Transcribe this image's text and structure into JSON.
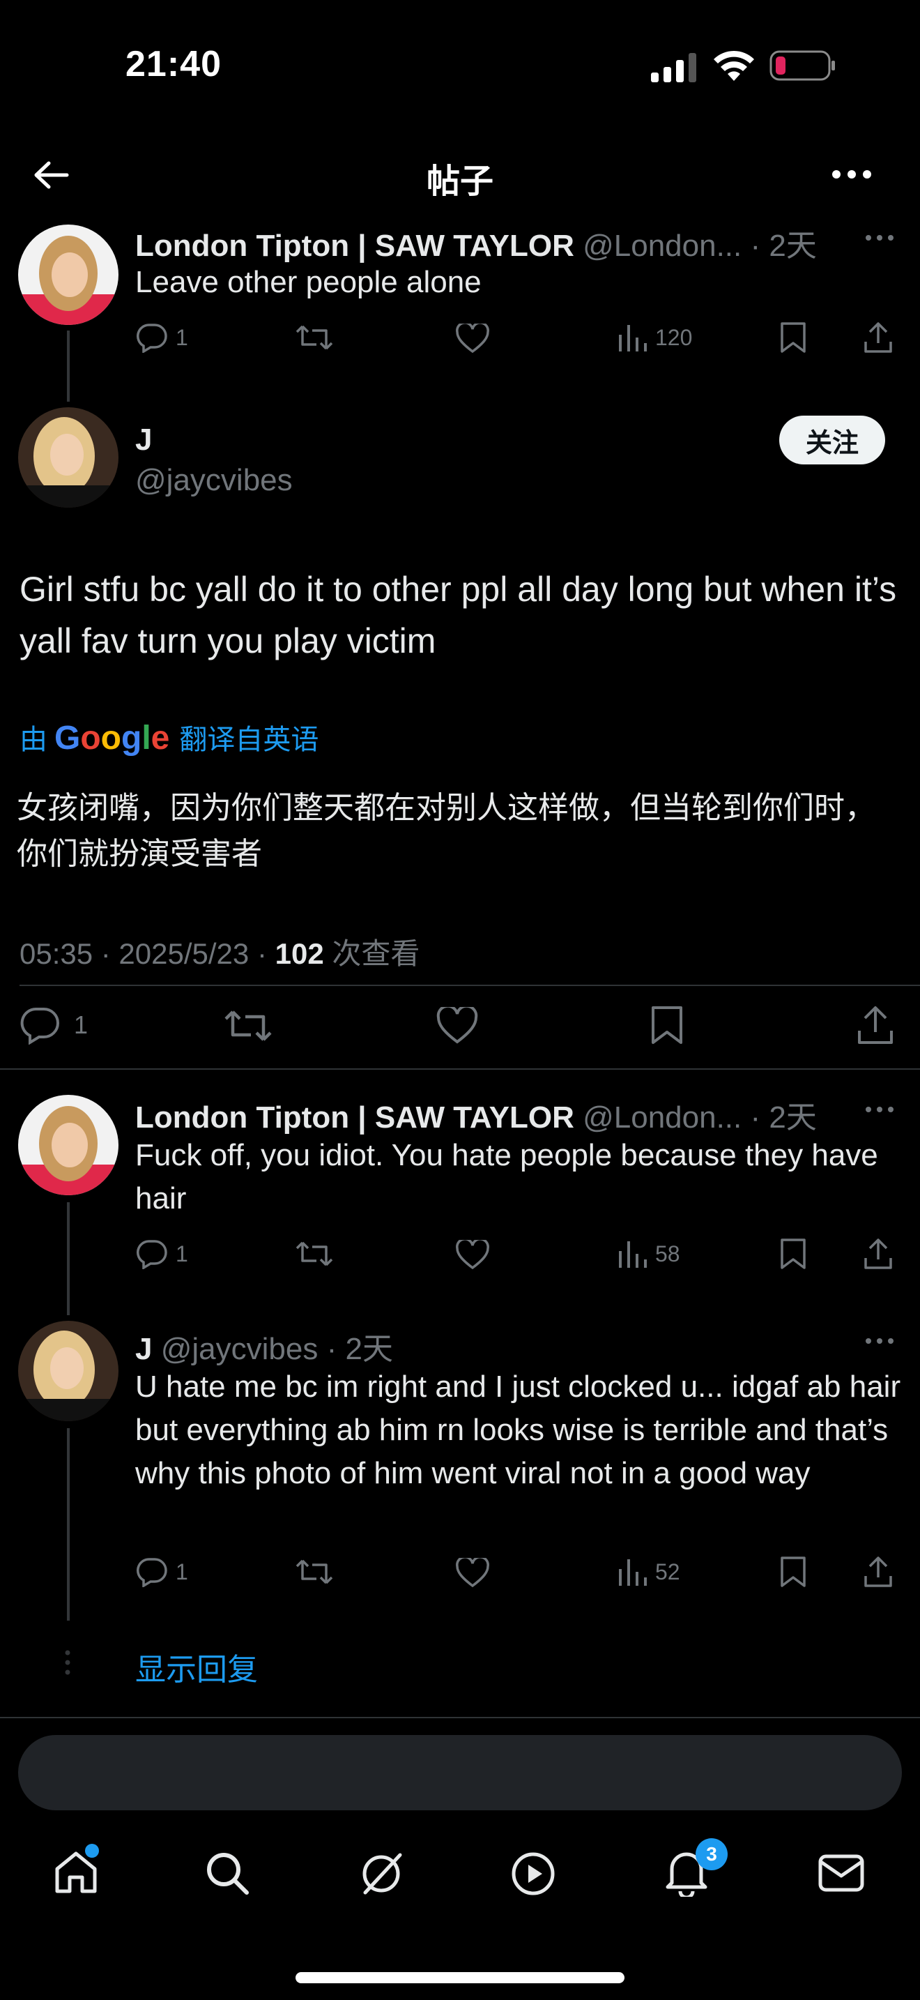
{
  "status_bar": {
    "time": "21:40"
  },
  "header": {
    "title": "帖子"
  },
  "parent_tweet": {
    "name": "London Tipton | SAW TAYLOR",
    "handle": "@London...",
    "time": "· 2天",
    "text": "Leave other people alone",
    "replies": "1",
    "views": "120"
  },
  "main_tweet": {
    "name": "J",
    "handle": "@jaycvibes",
    "follow_label": "关注",
    "text": "Girl stfu bc yall do it to other ppl all day long but when it’s yall fav turn you play victim",
    "translate_prefix": "由",
    "translate_brand": "Google",
    "translate_suffix": "翻译自英语",
    "translation": "女孩闭嘴，因为你们整天都在对别人这样做，但当轮到你们时，你们就扮演受害者",
    "timestamp": "05:35 · 2025/5/23 ·",
    "view_count": "102",
    "view_label": "次查看",
    "replies": "1"
  },
  "reply1": {
    "name": "London Tipton | SAW TAYLOR",
    "handle": "@London...",
    "time": "· 2天",
    "text": "Fuck off, you idiot. You hate people because they have hair",
    "replies": "1",
    "views": "58"
  },
  "reply2": {
    "name": "J",
    "handle": "@jaycvibes",
    "time": "· 2天",
    "text": "U hate me bc im right and I just clocked u... idgaf ab hair but everything ab him rn looks wise is terrible and that’s why this photo of him went viral not in a good way",
    "replies": "1",
    "views": "52"
  },
  "show_replies": "显示回复",
  "reply_input": {
    "placeholder": ""
  },
  "bottom_nav": {
    "notifications_badge": "3"
  },
  "colors": {
    "accent": "#1d9bf0",
    "background": "#000000",
    "muted": "#71767b",
    "text": "#e7e9ea",
    "battery_low": "#e0245e"
  }
}
